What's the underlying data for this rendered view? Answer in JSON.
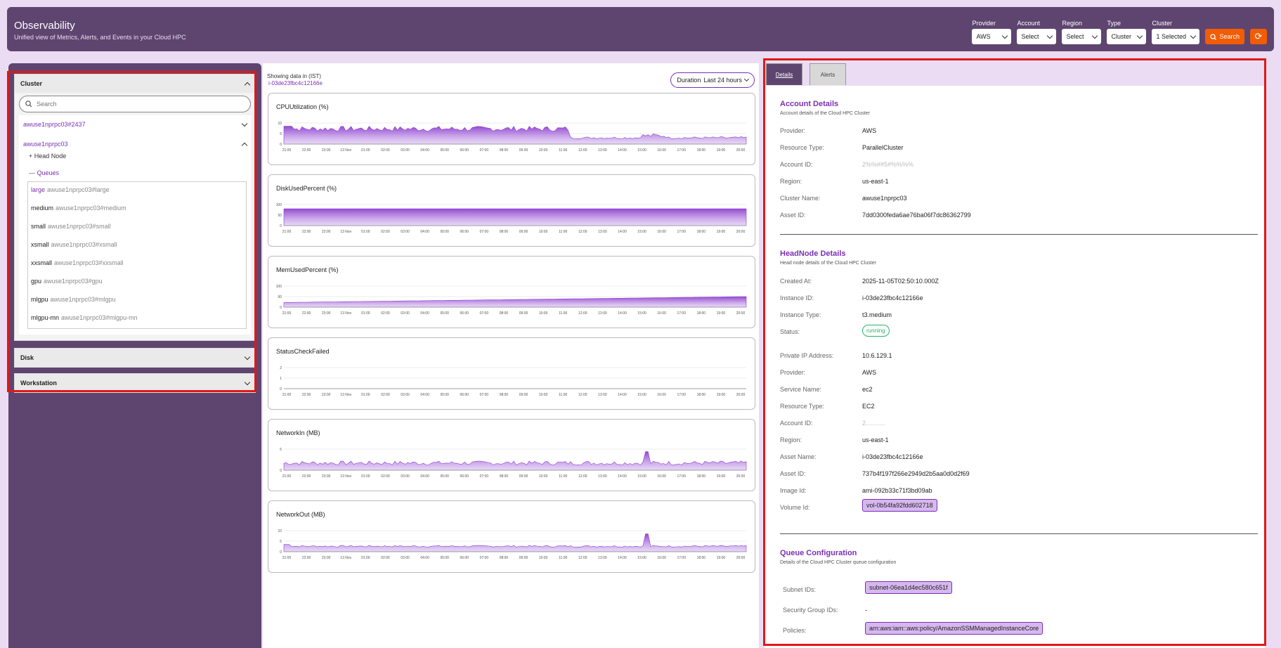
{
  "header": {
    "title": "Observability",
    "subtitle": "Unified view of Metrics, Alerts, and Events in your Cloud HPC",
    "filters": [
      {
        "label": "Provider",
        "value": "AWS"
      },
      {
        "label": "Account",
        "value": "Select"
      },
      {
        "label": "Region",
        "value": "Select"
      },
      {
        "label": "Type",
        "value": "Cluster"
      },
      {
        "label": "Cluster",
        "value": "1 Selected"
      }
    ],
    "search_label": "Search",
    "refresh_icon": "refresh-icon"
  },
  "sidebar": {
    "cluster_header": "Cluster",
    "search_placeholder": "Search",
    "clusters": [
      {
        "name": "awuse1nprpc03#2437"
      },
      {
        "name": "awuse1nprpc03"
      }
    ],
    "head_node_label": "+ Head Node",
    "queues_label": "— Queues",
    "queues": [
      {
        "name": "large",
        "id": "awuse1nprpc03#large"
      },
      {
        "name": "medium",
        "id": "awuse1nprpc03#medium"
      },
      {
        "name": "small",
        "id": "awuse1nprpc03#small"
      },
      {
        "name": "xsmall",
        "id": "awuse1nprpc03#xsmall"
      },
      {
        "name": "xxsmall",
        "id": "awuse1nprpc03#xxsmall"
      },
      {
        "name": "gpu",
        "id": "awuse1nprpc03#gpu"
      },
      {
        "name": "mlgpu",
        "id": "awuse1nprpc03#mlgpu"
      },
      {
        "name": "mlgpu-mn",
        "id": "awuse1nprpc03#mlgpu-mn"
      }
    ],
    "disk_header": "Disk",
    "workstation_header": "Workstation"
  },
  "metrics": {
    "showing": "Showing data in (IST)",
    "instance_id": "i-03de23fbc4c12166e",
    "duration_label": "Duration",
    "duration_value": "Last 24 hours",
    "x_ticks": [
      "21:00",
      "22:00",
      "23:00",
      "13 Nov",
      "01:00",
      "02:00",
      "03:00",
      "04:00",
      "05:00",
      "06:00",
      "07:00",
      "08:00",
      "09:00",
      "10:00",
      "11:00",
      "12:00",
      "13:00",
      "14:00",
      "15:00",
      "16:00",
      "17:00",
      "18:00",
      "19:00",
      "20:00"
    ],
    "charts": [
      {
        "title": "CPUUtilization  (%)",
        "yticks": [
          "10",
          "5",
          "0"
        ],
        "ymax": 10,
        "profile": "cpu"
      },
      {
        "title": "DiskUsedPercent  (%)",
        "yticks": [
          "100",
          "50",
          "0"
        ],
        "ymax": 100,
        "profile": "disk"
      },
      {
        "title": "MemUsedPercent  (%)",
        "yticks": [
          "100",
          "50",
          "0"
        ],
        "ymax": 100,
        "profile": "mem"
      },
      {
        "title": "StatusCheckFailed",
        "yticks": [
          "2",
          "1",
          "0"
        ],
        "ymax": 2,
        "profile": "zero"
      },
      {
        "title": "NetworkIn  (MB)",
        "yticks": [
          "5",
          "0"
        ],
        "ymax": 5,
        "profile": "netin"
      },
      {
        "title": "NetworkOut  (MB)",
        "yticks": [
          "10",
          "5",
          "0"
        ],
        "ymax": 10,
        "profile": "netout"
      }
    ]
  },
  "details": {
    "tabs": [
      "Details",
      "Alerts"
    ],
    "account": {
      "title": "Account Details",
      "desc": "Account details of the Cloud HPC Cluster",
      "rows": [
        {
          "k": "Provider:",
          "v": "AWS"
        },
        {
          "k": "Resource Type:",
          "v": "ParallelCluster"
        },
        {
          "k": "Account ID:",
          "v": "2%%##5#%%%%"
        },
        {
          "k": "Region:",
          "v": "us-east-1"
        },
        {
          "k": "Cluster Name:",
          "v": "awuse1nprpc03"
        },
        {
          "k": "Asset ID:",
          "v": "7dd0300feda6ae76ba06f7dc86362799"
        }
      ]
    },
    "headnode": {
      "title": "HeadNode Details",
      "desc": "Head node details of the Cloud HPC Cluster",
      "created_k": "Created At:",
      "created_v": "2025-11-05T02:50:10.000Z",
      "instance_k": "Instance ID:",
      "instance_v": "i-03de23fbc4c12166e",
      "itype_k": "Instance Type:",
      "itype_v": "t3.medium",
      "status_k": "Status:",
      "status_v": "running",
      "ip_k": "Private IP Address:",
      "ip_v": "10.6.129.1",
      "prov_k": "Provider:",
      "prov_v": "AWS",
      "svc_k": "Service Name:",
      "svc_v": "ec2",
      "rt_k": "Resource Type:",
      "rt_v": "EC2",
      "acct_k": "Account ID:",
      "acct_v": "2...........",
      "region_k": "Region:",
      "region_v": "us-east-1",
      "aname_k": "Asset Name:",
      "aname_v": "i-03de23fbc4c12166e",
      "aid_k": "Asset ID:",
      "aid_v": "737b4f197f266e2949d2b5aa0d0d2f69",
      "img_k": "Image Id:",
      "img_v": "ami-092b33c71f3bd09ab",
      "vol_k": "Volume Id:",
      "vol_v": "vol-0b54fa92fdd602718"
    },
    "queue": {
      "title": "Queue Configuration",
      "desc": "Details of the Cloud HPC Cluster queue configuration",
      "subnet_k": "Subnet IDs:",
      "subnet_v": "subnet-06ea1d4ec580c651f",
      "sg_k": "Security Group IDs:",
      "sg_v": "-",
      "pol_k": "Policies:",
      "pol_v": "arn:aws:iam::aws:policy/AmazonSSMManagedInstanceCore"
    }
  }
}
